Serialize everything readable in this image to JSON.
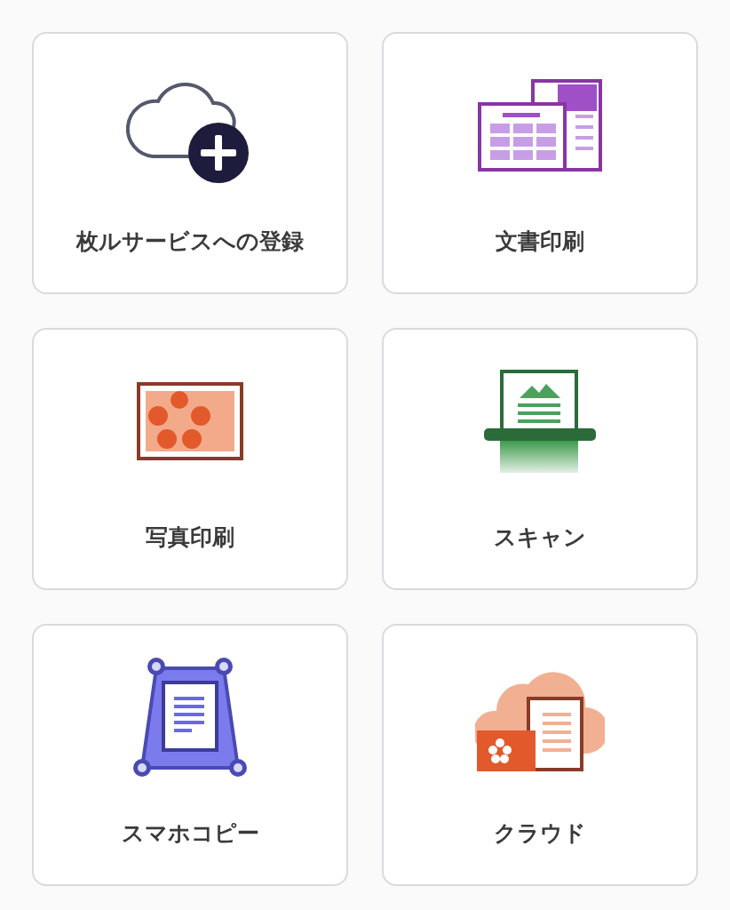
{
  "tiles": [
    {
      "kind": "cloud-add",
      "label": "枚ルサービスへの登録"
    },
    {
      "kind": "documents",
      "label": "文書印刷"
    },
    {
      "kind": "photo",
      "label": "写真印刷"
    },
    {
      "kind": "scanner",
      "label": "スキャン"
    },
    {
      "kind": "phone-copy",
      "label": "スマホコピー"
    },
    {
      "kind": "cloud",
      "label": "クラウド"
    }
  ]
}
